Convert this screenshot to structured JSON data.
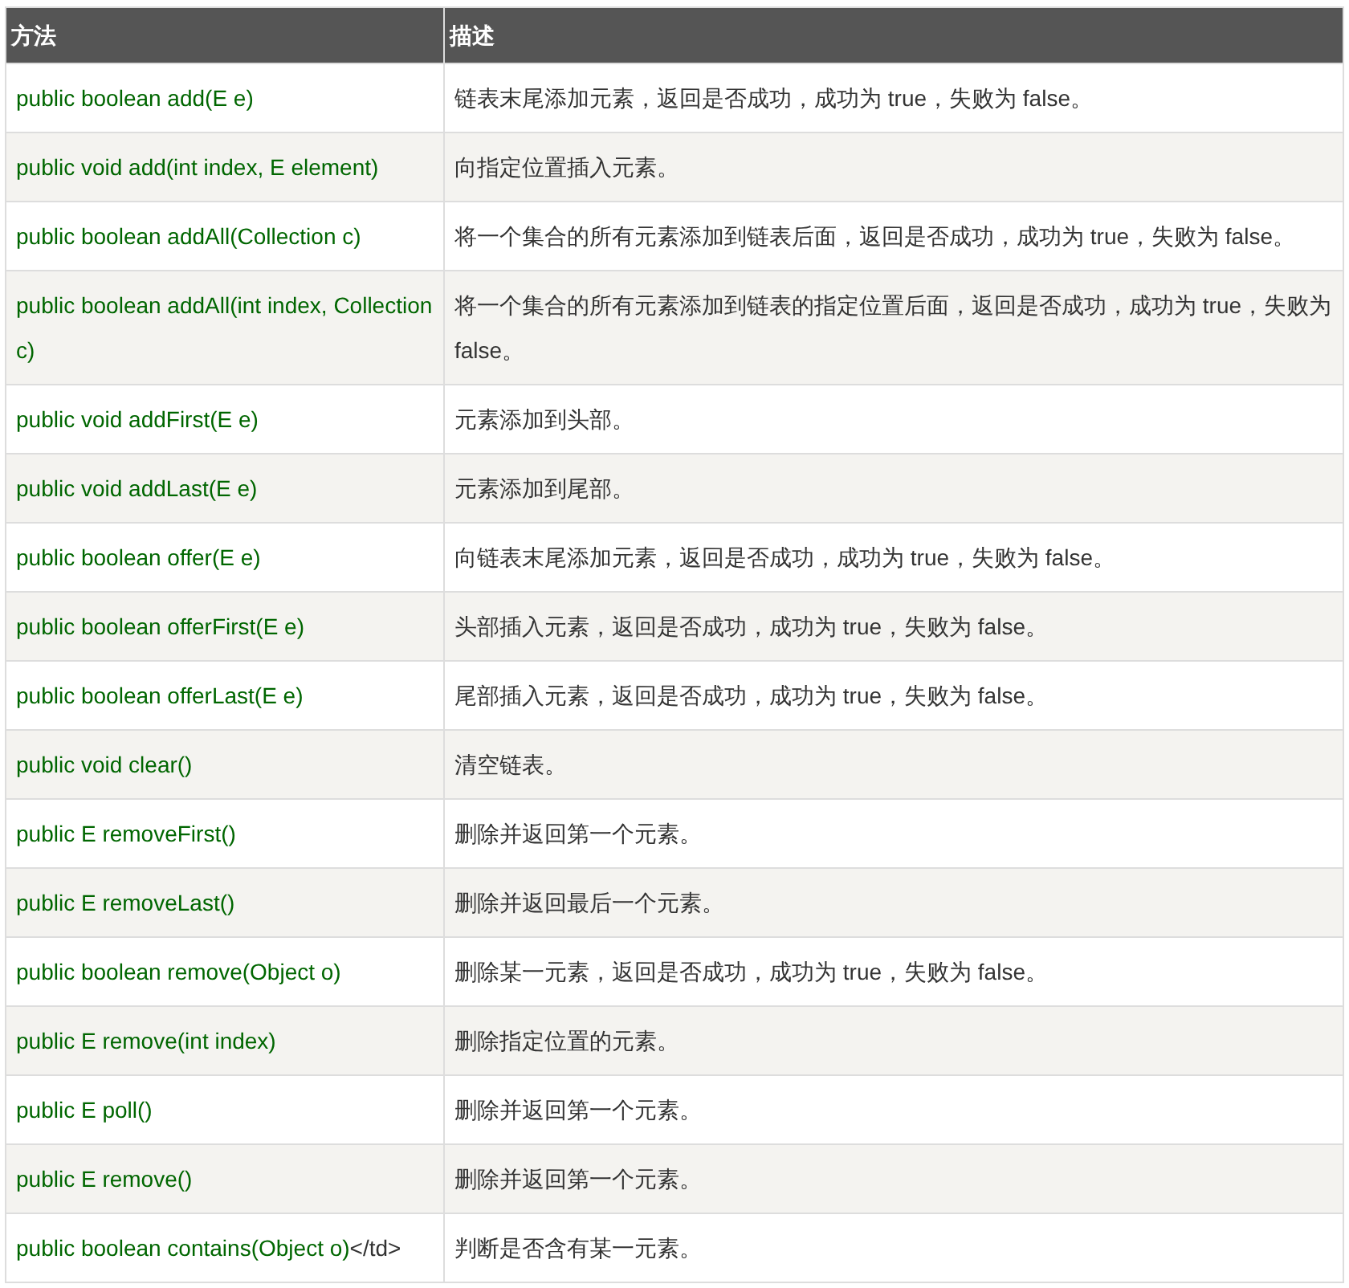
{
  "table": {
    "columns": [
      "方法",
      "描述"
    ],
    "rows": [
      {
        "method": "public boolean add(E e)",
        "description": "链表末尾添加元素，返回是否成功，成功为 true，失败为 false。"
      },
      {
        "method": "public void add(int index, E element)",
        "description": "向指定位置插入元素。"
      },
      {
        "method": "public boolean addAll(Collection c)",
        "description": "将一个集合的所有元素添加到链表后面，返回是否成功，成功为 true，失败为 false。"
      },
      {
        "method": "public boolean addAll(int index, Collection c)",
        "description": "将一个集合的所有元素添加到链表的指定位置后面，返回是否成功，成功为 true，失败为 false。"
      },
      {
        "method": "public void addFirst(E e)",
        "description": "元素添加到头部。"
      },
      {
        "method": "public void addLast(E e)",
        "description": "元素添加到尾部。"
      },
      {
        "method": "public boolean offer(E e)",
        "description": "向链表末尾添加元素，返回是否成功，成功为 true，失败为 false。"
      },
      {
        "method": "public boolean offerFirst(E e)",
        "description": "头部插入元素，返回是否成功，成功为 true，失败为 false。"
      },
      {
        "method": "public boolean offerLast(E e)",
        "description": "尾部插入元素，返回是否成功，成功为 true，失败为 false。"
      },
      {
        "method": "public void clear()",
        "description": "清空链表。"
      },
      {
        "method": "public E removeFirst()",
        "description": "删除并返回第一个元素。"
      },
      {
        "method": "public E removeLast()",
        "description": "删除并返回最后一个元素。"
      },
      {
        "method": "public boolean remove(Object o)",
        "description": "删除某一元素，返回是否成功，成功为 true，失败为 false。"
      },
      {
        "method": "public E remove(int index)",
        "description": "删除指定位置的元素。"
      },
      {
        "method": "public E poll()",
        "description": "删除并返回第一个元素。"
      },
      {
        "method": "public E remove()",
        "description": "删除并返回第一个元素。"
      },
      {
        "method": "public boolean contains(Object o)",
        "extra": "</td>",
        "description": "判断是否含有某一元素。"
      }
    ]
  }
}
